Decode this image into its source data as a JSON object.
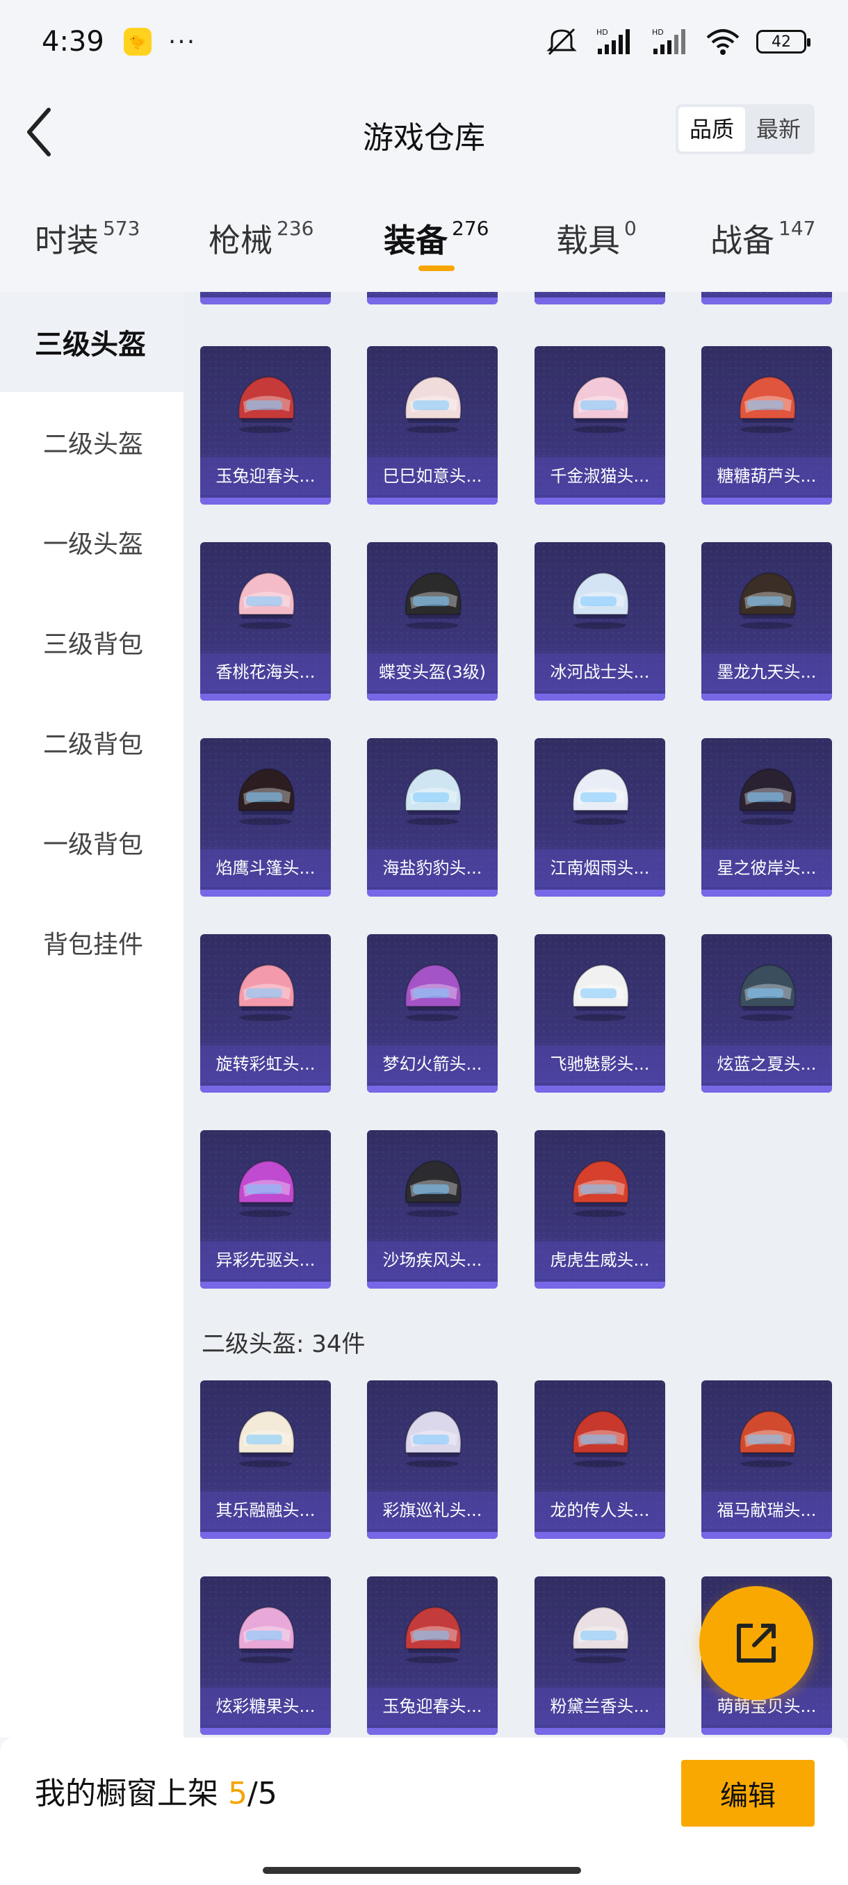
{
  "status_bar": {
    "time": "4:39",
    "dots": "···",
    "battery": "42"
  },
  "header": {
    "title": "游戏仓库",
    "sort": {
      "quality": "品质",
      "latest": "最新"
    }
  },
  "tabs": [
    {
      "label": "时装",
      "count": "573"
    },
    {
      "label": "枪械",
      "count": "236"
    },
    {
      "label": "装备",
      "count": "276"
    },
    {
      "label": "载具",
      "count": "0"
    },
    {
      "label": "战备",
      "count": "147"
    }
  ],
  "sidebar": [
    "三级头盔",
    "二级头盔",
    "一级头盔",
    "三级背包",
    "二级背包",
    "一级背包",
    "背包挂件"
  ],
  "level3": [
    "玉兔迎春头...",
    "巳巳如意头...",
    "千金淑猫头...",
    "糖糖葫芦头...",
    "香桃花海头...",
    "蝶变头盔(3级)",
    "冰河战士头...",
    "墨龙九天头...",
    "焰鹰斗篷头...",
    "海盐豹豹头...",
    "江南烟雨头...",
    "星之彼岸头...",
    "旋转彩虹头...",
    "梦幻火箭头...",
    "飞驰魅影头...",
    "炫蓝之夏头...",
    "异彩先驱头...",
    "沙场疾风头...",
    "虎虎生威头..."
  ],
  "level2_header": "二级头盔: 34件",
  "level2": [
    "其乐融融头...",
    "彩旗巡礼头...",
    "龙的传人头...",
    "福马献瑞头...",
    "炫彩糖果头...",
    "玉兔迎春头...",
    "粉黛兰香头...",
    "萌萌宝贝头..."
  ],
  "helmet_colors": [
    "#c63a3a",
    "#f1dcdc",
    "#f3c8d8",
    "#e0553e",
    "#f3bcc8",
    "#2b2b2b",
    "#d5e4f4",
    "#3a2e26",
    "#2c1e20",
    "#cfe6f2",
    "#e9eef6",
    "#2a2232",
    "#f39aac",
    "#a454c6",
    "#f1f1f1",
    "#3a4e5e",
    "#c04ad0",
    "#2b2b30",
    "#d6402c",
    "#f3ead8",
    "#dcd8ec",
    "#c8382c",
    "#d24a2e",
    "#e8a8d8",
    "#c43b3b",
    "#eadfe3",
    "#f0c040"
  ],
  "footer": {
    "prefix": "我的橱窗上架 ",
    "used": "5",
    "total": "/5",
    "edit": "编辑"
  }
}
